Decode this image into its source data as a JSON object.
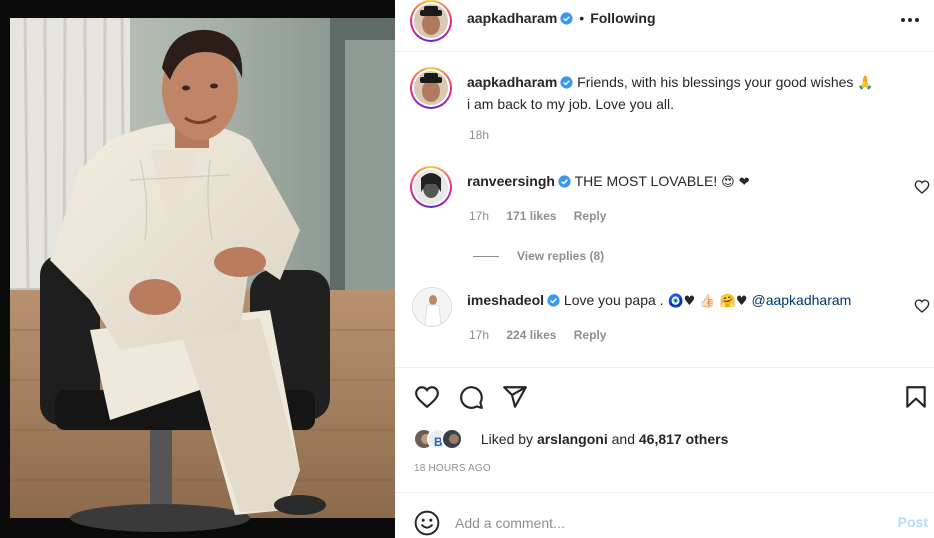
{
  "post_header": {
    "username": "aapkadharam",
    "separator": "•",
    "following_label": "Following",
    "more_icon": "more-horizontal-icon"
  },
  "caption": {
    "username": "aapkadharam",
    "text_line1": "Friends, with his blessings your good wishes",
    "emoji": "🙏",
    "text_line2": "i am back to my job. Love you all.",
    "time": "18h"
  },
  "comments": [
    {
      "username": "ranveersingh",
      "text": "THE MOST LOVABLE!",
      "emoji": "😍 ❤",
      "time": "17h",
      "likes": "171 likes",
      "reply_label": "Reply",
      "view_replies": "View replies (8)"
    },
    {
      "username": "imeshadeol",
      "text": "Love you papa .",
      "emoji": "🧿♥ 👍🏻 🤗♥",
      "mention": "@aapkadharam",
      "time": "17h",
      "likes": "224 likes",
      "reply_label": "Reply"
    }
  ],
  "actions": {
    "like_icon": "heart-icon",
    "comment_icon": "comment-icon",
    "share_icon": "send-icon",
    "save_icon": "bookmark-icon"
  },
  "likes": {
    "prefix": "Liked by",
    "user": "arslangoni",
    "connector": "and",
    "others": "46,817 others"
  },
  "timestamp": "18 HOURS AGO",
  "add_comment": {
    "placeholder": "Add a comment...",
    "post_label": "Post",
    "emoji_icon": "smiley-icon"
  },
  "colors": {
    "verified": "#3897f0",
    "link": "#00376b",
    "muted": "#8e8e8e",
    "post_disabled": "#b3dbff"
  }
}
